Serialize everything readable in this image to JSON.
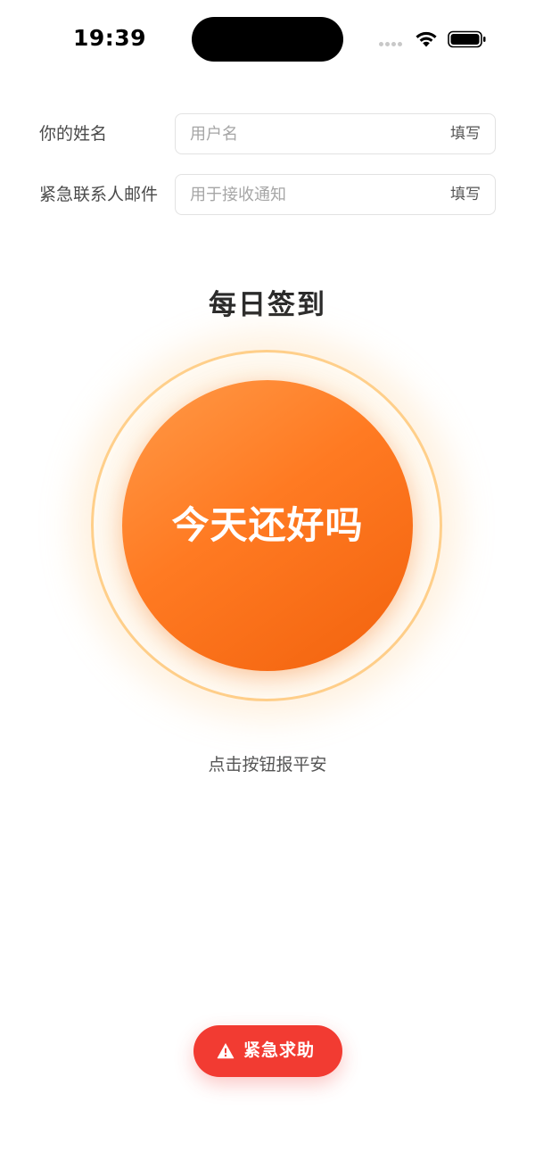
{
  "status_bar": {
    "time": "19:39"
  },
  "form": {
    "name": {
      "label": "你的姓名",
      "value": "",
      "placeholder": "用户名",
      "action": "填写"
    },
    "emergency_email": {
      "label": "紧急联系人邮件",
      "value": "",
      "placeholder": "用于接收通知",
      "action": "填写"
    }
  },
  "checkin": {
    "title": "每日签到",
    "button_label": "今天还好吗",
    "hint": "点击按钮报平安"
  },
  "emergency": {
    "button_label": "紧急求助",
    "icon": "warning-icon"
  },
  "colors": {
    "accent_orange": "#ff7a22",
    "glow": "#ffcf8a",
    "sos_red": "#f23b32"
  }
}
